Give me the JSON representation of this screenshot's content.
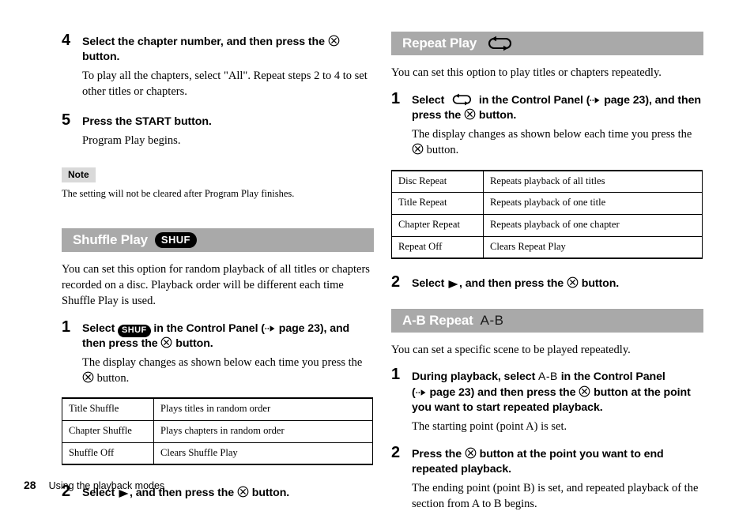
{
  "page": {
    "number": "28",
    "footer_title": "Using the playback modes"
  },
  "icons": {
    "cross_button": "cross-circle-icon",
    "dotted_arrow": "dotted-arrow-icon",
    "play_triangle": "play-triangle-icon",
    "repeat_loop": "repeat-loop-icon",
    "shuf_badge": "shuf-badge-icon"
  },
  "colors": {
    "section_bar": "#a9a9a9",
    "note_badge": "#d9d9d9",
    "badge_fill": "#000000",
    "badge_text": "#ffffff",
    "text": "#000000"
  },
  "left_column": {
    "step4": {
      "number": "4",
      "head_a": "Select the chapter number, and then press the ",
      "head_b": " button.",
      "sub": "To play all the chapters, select \"All\". Repeat steps 2 to 4 to set other titles or chapters."
    },
    "step5": {
      "number": "5",
      "head": "Press the START button.",
      "sub": "Program Play begins."
    },
    "note": {
      "label": "Note",
      "text": "The setting will not be cleared after Program Play finishes."
    },
    "shuffle": {
      "title": "Shuffle Play",
      "badge": "SHUF",
      "intro": "You can set this option for random playback of all titles or chapters recorded on a disc. Playback order will be different each time Shuffle Play is used.",
      "step1": {
        "number": "1",
        "head_a": "Select ",
        "badge": "SHUF",
        "head_b": " in the Control Panel (",
        "head_c": " page 23), and then press the ",
        "head_d": " button.",
        "sub_a": "The display changes as shown below each time you press the ",
        "sub_b": " button."
      },
      "table": {
        "rows": [
          {
            "option": "Title Shuffle",
            "description": "Plays titles in random order"
          },
          {
            "option": "Chapter Shuffle",
            "description": "Plays chapters in random order"
          },
          {
            "option": "Shuffle Off",
            "description": "Clears Shuffle Play"
          }
        ]
      },
      "step2": {
        "number": "2",
        "head_a": "Select ",
        "head_b": ", and then press the ",
        "head_c": " button."
      }
    }
  },
  "right_column": {
    "repeat": {
      "title": "Repeat Play",
      "badge": "repeat-loop-icon",
      "intro": "You can set this option to play titles or chapters repeatedly.",
      "step1": {
        "number": "1",
        "head_a": "Select ",
        "head_b": " in the Control Panel (",
        "head_c": " page 23), and then press the ",
        "head_d": " button.",
        "sub_a": "The display changes as shown below each time you press the ",
        "sub_b": " button."
      },
      "table": {
        "rows": [
          {
            "option": "Disc Repeat",
            "description": "Repeats playback of all titles"
          },
          {
            "option": "Title Repeat",
            "description": "Repeats playback of one title"
          },
          {
            "option": "Chapter Repeat",
            "description": "Repeats playback of one chapter"
          },
          {
            "option": "Repeat Off",
            "description": "Clears Repeat Play"
          }
        ]
      },
      "step2": {
        "number": "2",
        "head_a": "Select ",
        "head_b": ", and then press the ",
        "head_c": " button."
      }
    },
    "ab_repeat": {
      "title": "A-B Repeat",
      "badge": "A-B",
      "intro": "You can set a specific scene to be played repeatedly.",
      "step1": {
        "number": "1",
        "head_a": "During playback, select ",
        "badge": "A-B",
        "head_b": " in the Control Panel",
        "head_c": "(",
        "head_d": " page 23) and then press the ",
        "head_e": " button at the point you want to start repeated playback.",
        "sub": "The starting point (point A) is set."
      },
      "step2": {
        "number": "2",
        "head_a": "Press the ",
        "head_b": " button at the point you want to end repeated playback.",
        "sub": "The ending point (point B) is set, and repeated playback of the section from A to B begins."
      }
    }
  }
}
